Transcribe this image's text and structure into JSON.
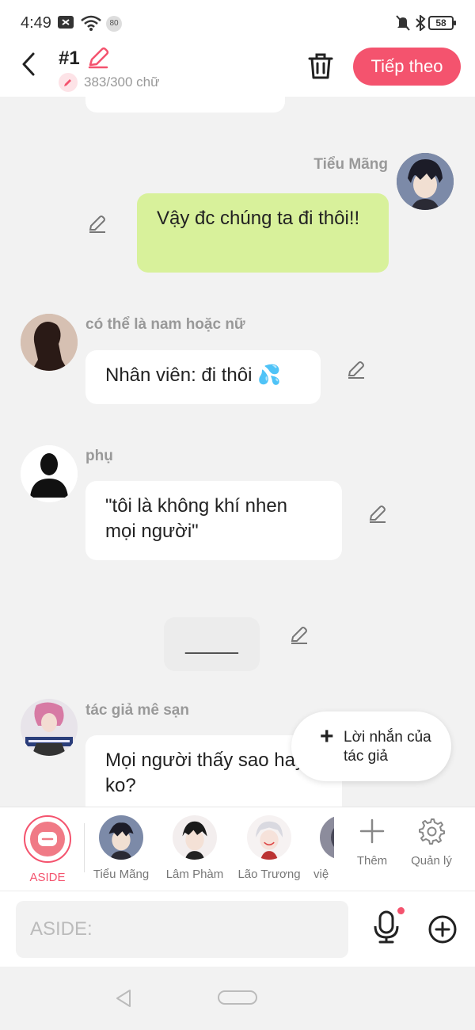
{
  "status": {
    "time": "4:49",
    "notification_count": "80",
    "battery": "58"
  },
  "header": {
    "title": "#1",
    "word_count": "383/300 chữ",
    "next_label": "Tiếp theo"
  },
  "messages": [
    {
      "name": "Tiểu Mãng",
      "text": "Vậy đc chúng ta đi thôi!!"
    },
    {
      "name": "có thể là nam hoặc nữ",
      "text": "Nhân viên: đi thôi 💦"
    },
    {
      "name": "phụ",
      "text": "\"tôi là không khí nhen mọi người\""
    },
    {
      "name": "",
      "text": "_____"
    },
    {
      "name": "tác giả mê sạn",
      "text": "Mọi người thấy sao hay ko?"
    }
  ],
  "author_note": {
    "label": "Lời nhắn của tác giả"
  },
  "characters": [
    {
      "label": "ASIDE"
    },
    {
      "label": "Tiểu Mãng"
    },
    {
      "label": "Lâm Phàm"
    },
    {
      "label": "Lão Trương"
    },
    {
      "label": "việ"
    }
  ],
  "tools": {
    "add_label": "Thêm",
    "manage_label": "Quản lý"
  },
  "input": {
    "placeholder": "ASIDE:"
  },
  "colors": {
    "accent": "#f4536e",
    "green_bubble": "#d8f19b",
    "background": "#f2f2f2"
  }
}
